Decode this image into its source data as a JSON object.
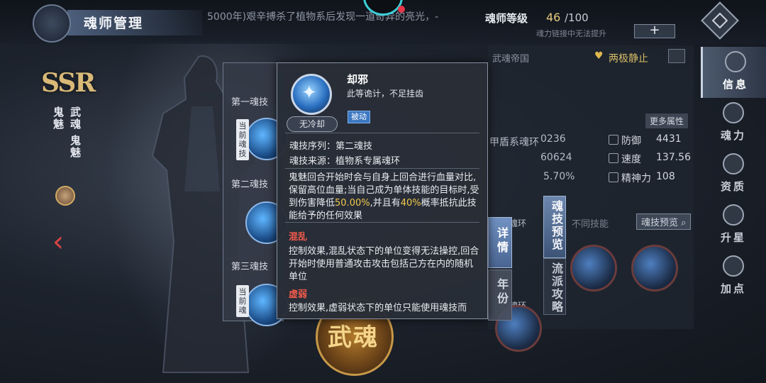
{
  "header": {
    "title": "魂师管理",
    "ticker": "5000年)艰辛搏杀了植物系后发现一道奇异的亮光，-",
    "level_label": "魂师等级",
    "level_value": "46",
    "level_max": "/100",
    "level_note": "魂力链接中无法提升",
    "plus_label": "+"
  },
  "sidenav": {
    "items": [
      {
        "label": "信息",
        "icon": "info-crest-icon",
        "active": true
      },
      {
        "label": "魂力",
        "icon": "soul-power-icon"
      },
      {
        "label": "资质",
        "icon": "aptitude-icon"
      },
      {
        "label": "升星",
        "icon": "star-up-icon"
      },
      {
        "label": "加点",
        "icon": "add-points-icon"
      }
    ]
  },
  "character": {
    "rarity": "SSR",
    "name": "鬼魅",
    "type1": "武魂",
    "type2": "鬼魅",
    "wuhun_text": "武魂",
    "back_arrow": "‹"
  },
  "skill_list": {
    "slots": [
      {
        "heading": "第一魂技",
        "current_tag": "当前魂技"
      },
      {
        "heading": "第二魂技"
      },
      {
        "heading": "第三魂技",
        "current_tag": "当前魂"
      }
    ]
  },
  "stats": {
    "nation": "武魂帝国",
    "pair_status": "两极静止",
    "more_attr": "更多属性",
    "fragments": [
      "甲盾系魂环",
      "0236",
      "60624",
      "5.70%"
    ],
    "rows": [
      {
        "label": "防御",
        "value": "4431"
      },
      {
        "label": "速度",
        "value": "137.56"
      },
      {
        "label": "精神力",
        "value": "108"
      }
    ],
    "ring_fragments": [
      "魂环",
      "魂环"
    ],
    "diff_skill": "不同技能",
    "preview_btn": "魂技预览",
    "tab_preview": "魂技预览",
    "tab_school": "流派攻略"
  },
  "popup": {
    "skill_name": "却邪",
    "short_desc": "此等诡计，不足挂齿",
    "type_tag": "被动",
    "cooldown": "无冷却",
    "seq_label": "魂技序列：第二魂技",
    "src_label": "魂技来源：植物系专属魂环",
    "effect_pre": "鬼魅回合开始时会与自身上回合进行血量对比,保留高位血量;当自己成为单体技能的目标时,受到伤害降低",
    "effect_hl1": "50.00%",
    "effect_mid": ",并且有",
    "effect_hl2": "40%",
    "effect_post": "概率抵抗此技能给予的任何效果",
    "kw1_title": "混乱",
    "kw1_text": "控制效果,混乱状态下的单位变得无法操控,回合开始时使用普通攻击攻击包括己方在内的随机单位",
    "kw2_title": "虚弱",
    "kw2_text": "控制效果,虚弱状态下的单位只能使用魂技而",
    "tab_detail": "详情",
    "tab_year": "年份"
  },
  "colors": {
    "accent_gold": "#e6c97d",
    "highlight": "#f2c94c",
    "keyword_red": "#ef5a4c",
    "passive_blue": "#3d78c2"
  }
}
